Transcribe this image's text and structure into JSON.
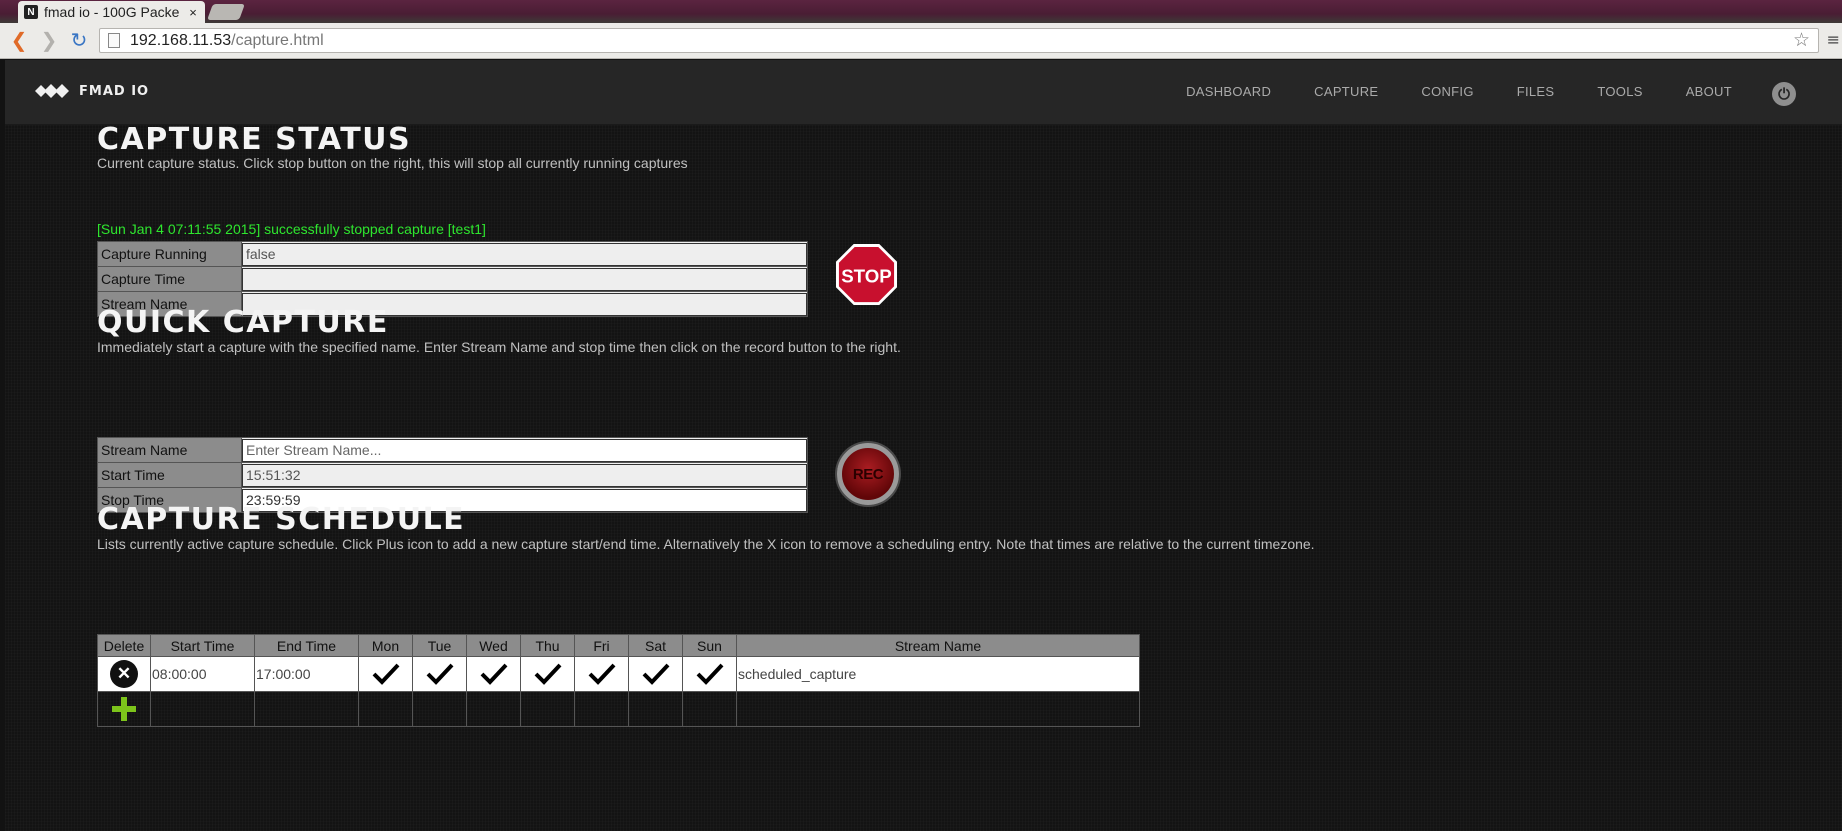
{
  "browser": {
    "tab_title": "fmad io - 100G Packe",
    "tab_favicon": "N",
    "tab_close": "×",
    "url_host": "192.168.11.53",
    "url_path": "/capture.html"
  },
  "navbar": {
    "logo_text": "FMAD IO",
    "links": [
      "DASHBOARD",
      "CAPTURE",
      "CONFIG",
      "FILES",
      "TOOLS",
      "ABOUT"
    ]
  },
  "capture_status": {
    "title": "CAPTURE STATUS",
    "description": "Current capture status. Click stop button on the right, this will stop all currently running captures",
    "message": "[Sun Jan 4 07:11:55 2015] successfully stopped capture [test1]",
    "rows": [
      {
        "label": "Capture Running",
        "value": "false"
      },
      {
        "label": "Capture Time",
        "value": ""
      },
      {
        "label": "Stream Name",
        "value": ""
      }
    ],
    "stop_label": "STOP"
  },
  "quick_capture": {
    "title": "QUICK CAPTURE",
    "description": "Immediately start a capture with the specified name. Enter Stream Name and stop time then click on the record button to the right.",
    "rows": [
      {
        "label": "Stream Name",
        "value": "",
        "placeholder": "Enter Stream Name..."
      },
      {
        "label": "Start Time",
        "value": "15:51:32",
        "placeholder": ""
      },
      {
        "label": "Stop Time",
        "value": "23:59:59",
        "placeholder": ""
      }
    ],
    "rec_label": "REC"
  },
  "capture_schedule": {
    "title": "CAPTURE SCHEDULE",
    "description": "Lists currently active capture schedule. Click Plus icon to add a new capture start/end time. Alternatively the X icon to remove a scheduling entry. Note that times are relative to the current timezone.",
    "headers": [
      "Delete",
      "Start Time",
      "End Time",
      "Mon",
      "Tue",
      "Wed",
      "Thu",
      "Fri",
      "Sat",
      "Sun",
      "Stream Name"
    ],
    "entries": [
      {
        "start": "08:00:00",
        "end": "17:00:00",
        "days": [
          true,
          true,
          true,
          true,
          true,
          true,
          true
        ],
        "stream": "scheduled_capture"
      }
    ]
  },
  "colors": {
    "status_message": "#2ee62e",
    "stop_sign": "#c8102e",
    "rec_button": "#8f1015",
    "add_icon": "#7dc41b"
  }
}
